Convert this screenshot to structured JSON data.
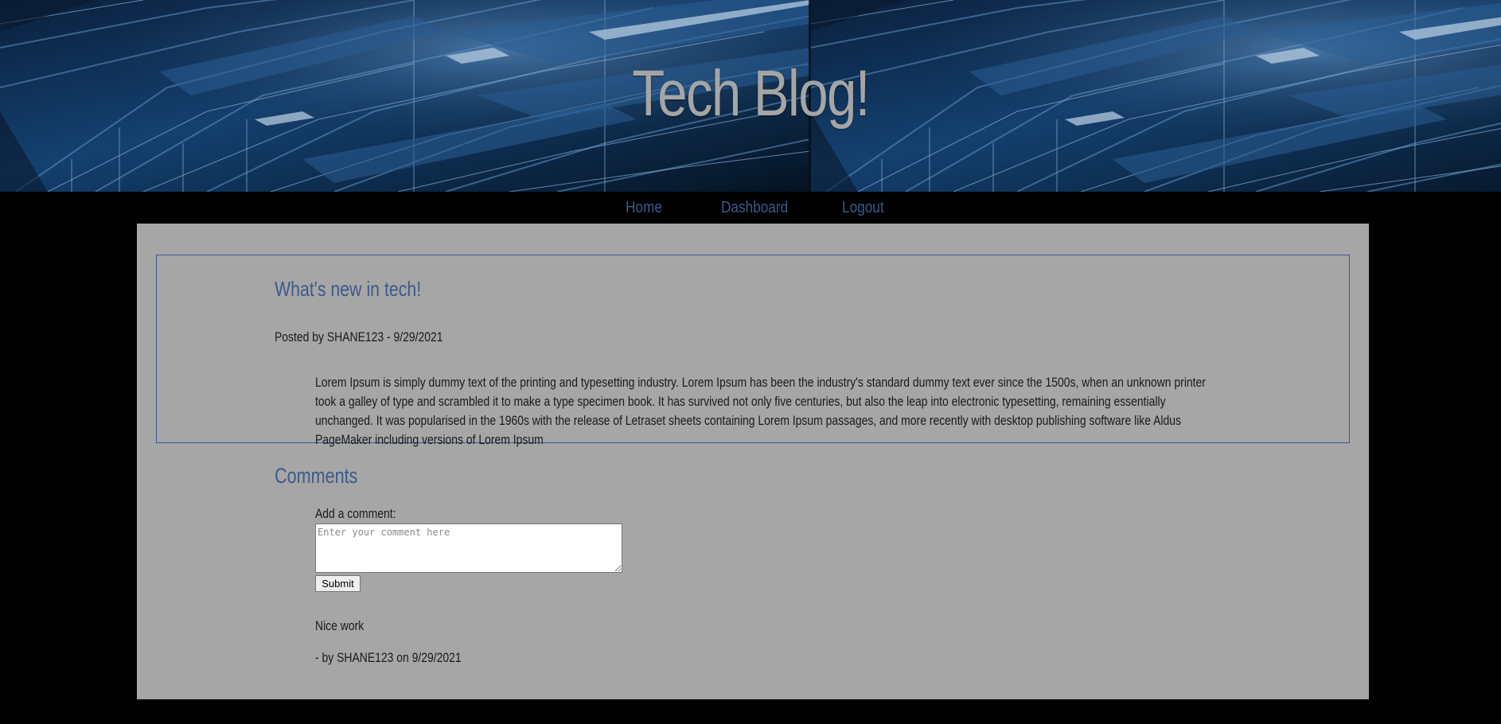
{
  "header": {
    "title": "Tech Blog!"
  },
  "nav": {
    "items": [
      {
        "label": "Home"
      },
      {
        "label": "Dashboard"
      },
      {
        "label": "Logout"
      }
    ]
  },
  "post": {
    "title": "What's new in tech!",
    "meta": "Posted by SHANE123 - 9/29/2021",
    "body": "Lorem Ipsum is simply dummy text of the printing and typesetting industry. Lorem Ipsum has been the industry's standard dummy text ever since the 1500s, when an unknown printer took a galley of type and scrambled it to make a type specimen book. It has survived not only five centuries, but also the leap into electronic typesetting, remaining essentially unchanged. It was popularised in the 1960s with the release of Letraset sheets containing Lorem Ipsum passages, and more recently with desktop publishing software like Aldus PageMaker including versions of Lorem Ipsum"
  },
  "comments": {
    "heading": "Comments",
    "form": {
      "label": "Add a comment:",
      "value": "",
      "placeholder": "Enter your comment here",
      "submit_label": "Submit"
    },
    "items": [
      {
        "text": "Nice work",
        "byline": "- by SHANE123 on 9/29/2021"
      }
    ]
  },
  "colors": {
    "page_background": "#000000",
    "panel_background": "#a6a6a6",
    "accent": "#3b5a8c",
    "title_text": "#a5a5a5",
    "body_text": "#1a1a1a"
  }
}
